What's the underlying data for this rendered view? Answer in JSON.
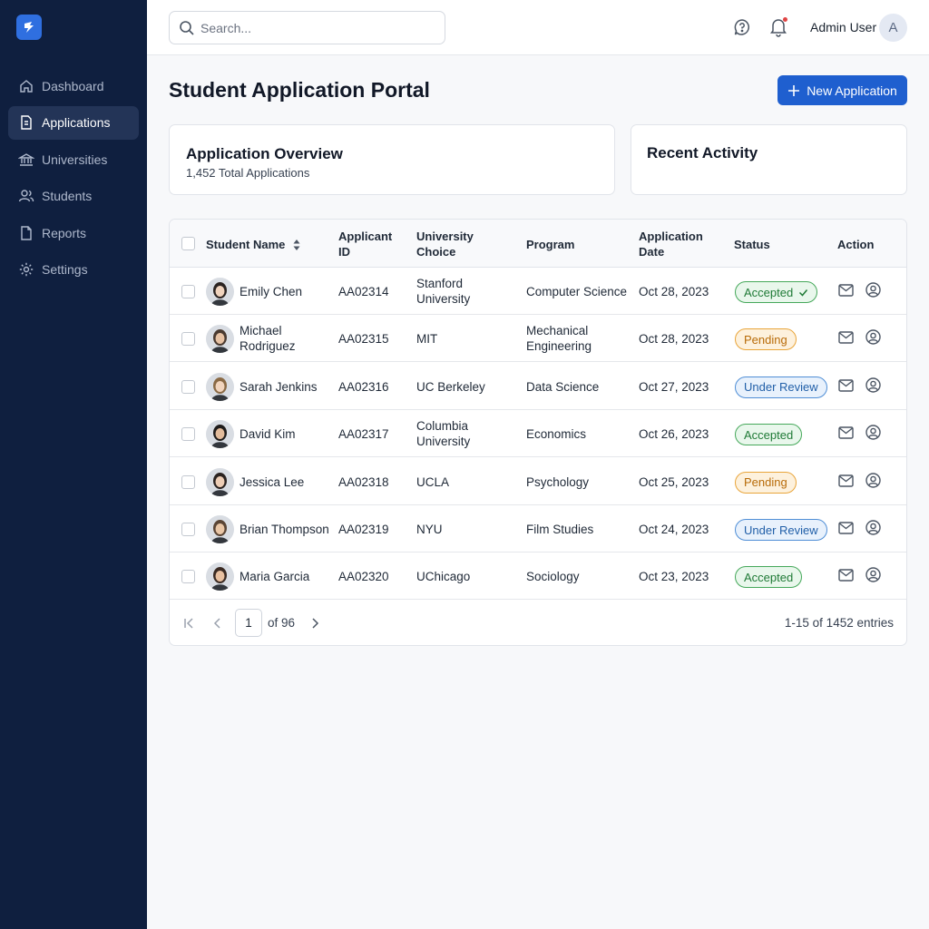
{
  "sidebar": {
    "items": [
      {
        "label": "Dashboard",
        "icon": "home-icon"
      },
      {
        "label": "Applications",
        "icon": "document-icon",
        "active": true
      },
      {
        "label": "Universities",
        "icon": "bank-icon"
      },
      {
        "label": "Students",
        "icon": "users-icon"
      },
      {
        "label": "Reports",
        "icon": "file-icon"
      },
      {
        "label": "Settings",
        "icon": "gear-icon"
      }
    ]
  },
  "header": {
    "search_placeholder": "Search...",
    "user_name": "Admin User",
    "avatar_initial": "A"
  },
  "main": {
    "title": "Student Application Portal",
    "new_button_label": "New Application",
    "overview": {
      "title": "Application Overview",
      "subtitle": "1,452 Total Applications"
    },
    "activity": {
      "title": "Recent Activity"
    }
  },
  "table": {
    "columns": {
      "name": "Student Name",
      "id_line1": "Applicant",
      "id_line2": "ID",
      "univ_line1": "University",
      "univ_line2": "Choice",
      "program": "Program",
      "date_line1": "Application",
      "date_line2": "Date",
      "status": "Status",
      "action": "Action"
    },
    "rows": [
      {
        "name1": "Emily Chen",
        "name2": "",
        "id": "AA02314",
        "univ1": "Stanford",
        "univ2": "University",
        "prog1": "Computer Science",
        "prog2": "",
        "date": "Oct 28, 2023",
        "status": "Accepted"
      },
      {
        "name1": "Michael",
        "name2": "Rodriguez",
        "id": "AA02315",
        "univ1": "MIT",
        "univ2": "",
        "prog1": "Mechanical",
        "prog2": "Engineering",
        "date": "Oct 28, 2023",
        "status": "Pending"
      },
      {
        "name1": "Sarah Jenkins",
        "name2": "",
        "id": "AA02316",
        "univ1": "UC Berkeley",
        "univ2": "",
        "prog1": "Data Science",
        "prog2": "",
        "date": "Oct 27, 2023",
        "status": "Under Review"
      },
      {
        "name1": "David Kim",
        "name2": "",
        "id": "AA02317",
        "univ1": "Columbia",
        "univ2": "University",
        "prog1": "Economics",
        "prog2": "",
        "date": "Oct 26, 2023",
        "status": "Accepted"
      },
      {
        "name1": "Jessica Lee",
        "name2": "",
        "id": "AA02318",
        "univ1": "UCLA",
        "univ2": "",
        "prog1": "Psychology",
        "prog2": "",
        "date": "Oct 25, 2023",
        "status": "Pending"
      },
      {
        "name1": "Brian Thompson",
        "name2": "",
        "id": "AA02319",
        "univ1": "NYU",
        "univ2": "",
        "prog1": "Film Studies",
        "prog2": "",
        "date": "Oct 24, 2023",
        "status": "Under Review"
      },
      {
        "name1": "Maria Garcia",
        "name2": "",
        "id": "AA02320",
        "univ1": "UChicago",
        "univ2": "",
        "prog1": "Sociology",
        "prog2": "",
        "date": "Oct 23, 2023",
        "status": "Accepted"
      }
    ]
  },
  "pagination": {
    "current_page": "1",
    "of_pages": "of 96",
    "entries": "1-15 of 1452 entries"
  },
  "colors": {
    "sidebar_bg": "#0f1f3f",
    "accent": "#1f5fcf",
    "accepted": "#45a85a",
    "pending": "#e9a53a",
    "under_review": "#4f8ed6"
  }
}
